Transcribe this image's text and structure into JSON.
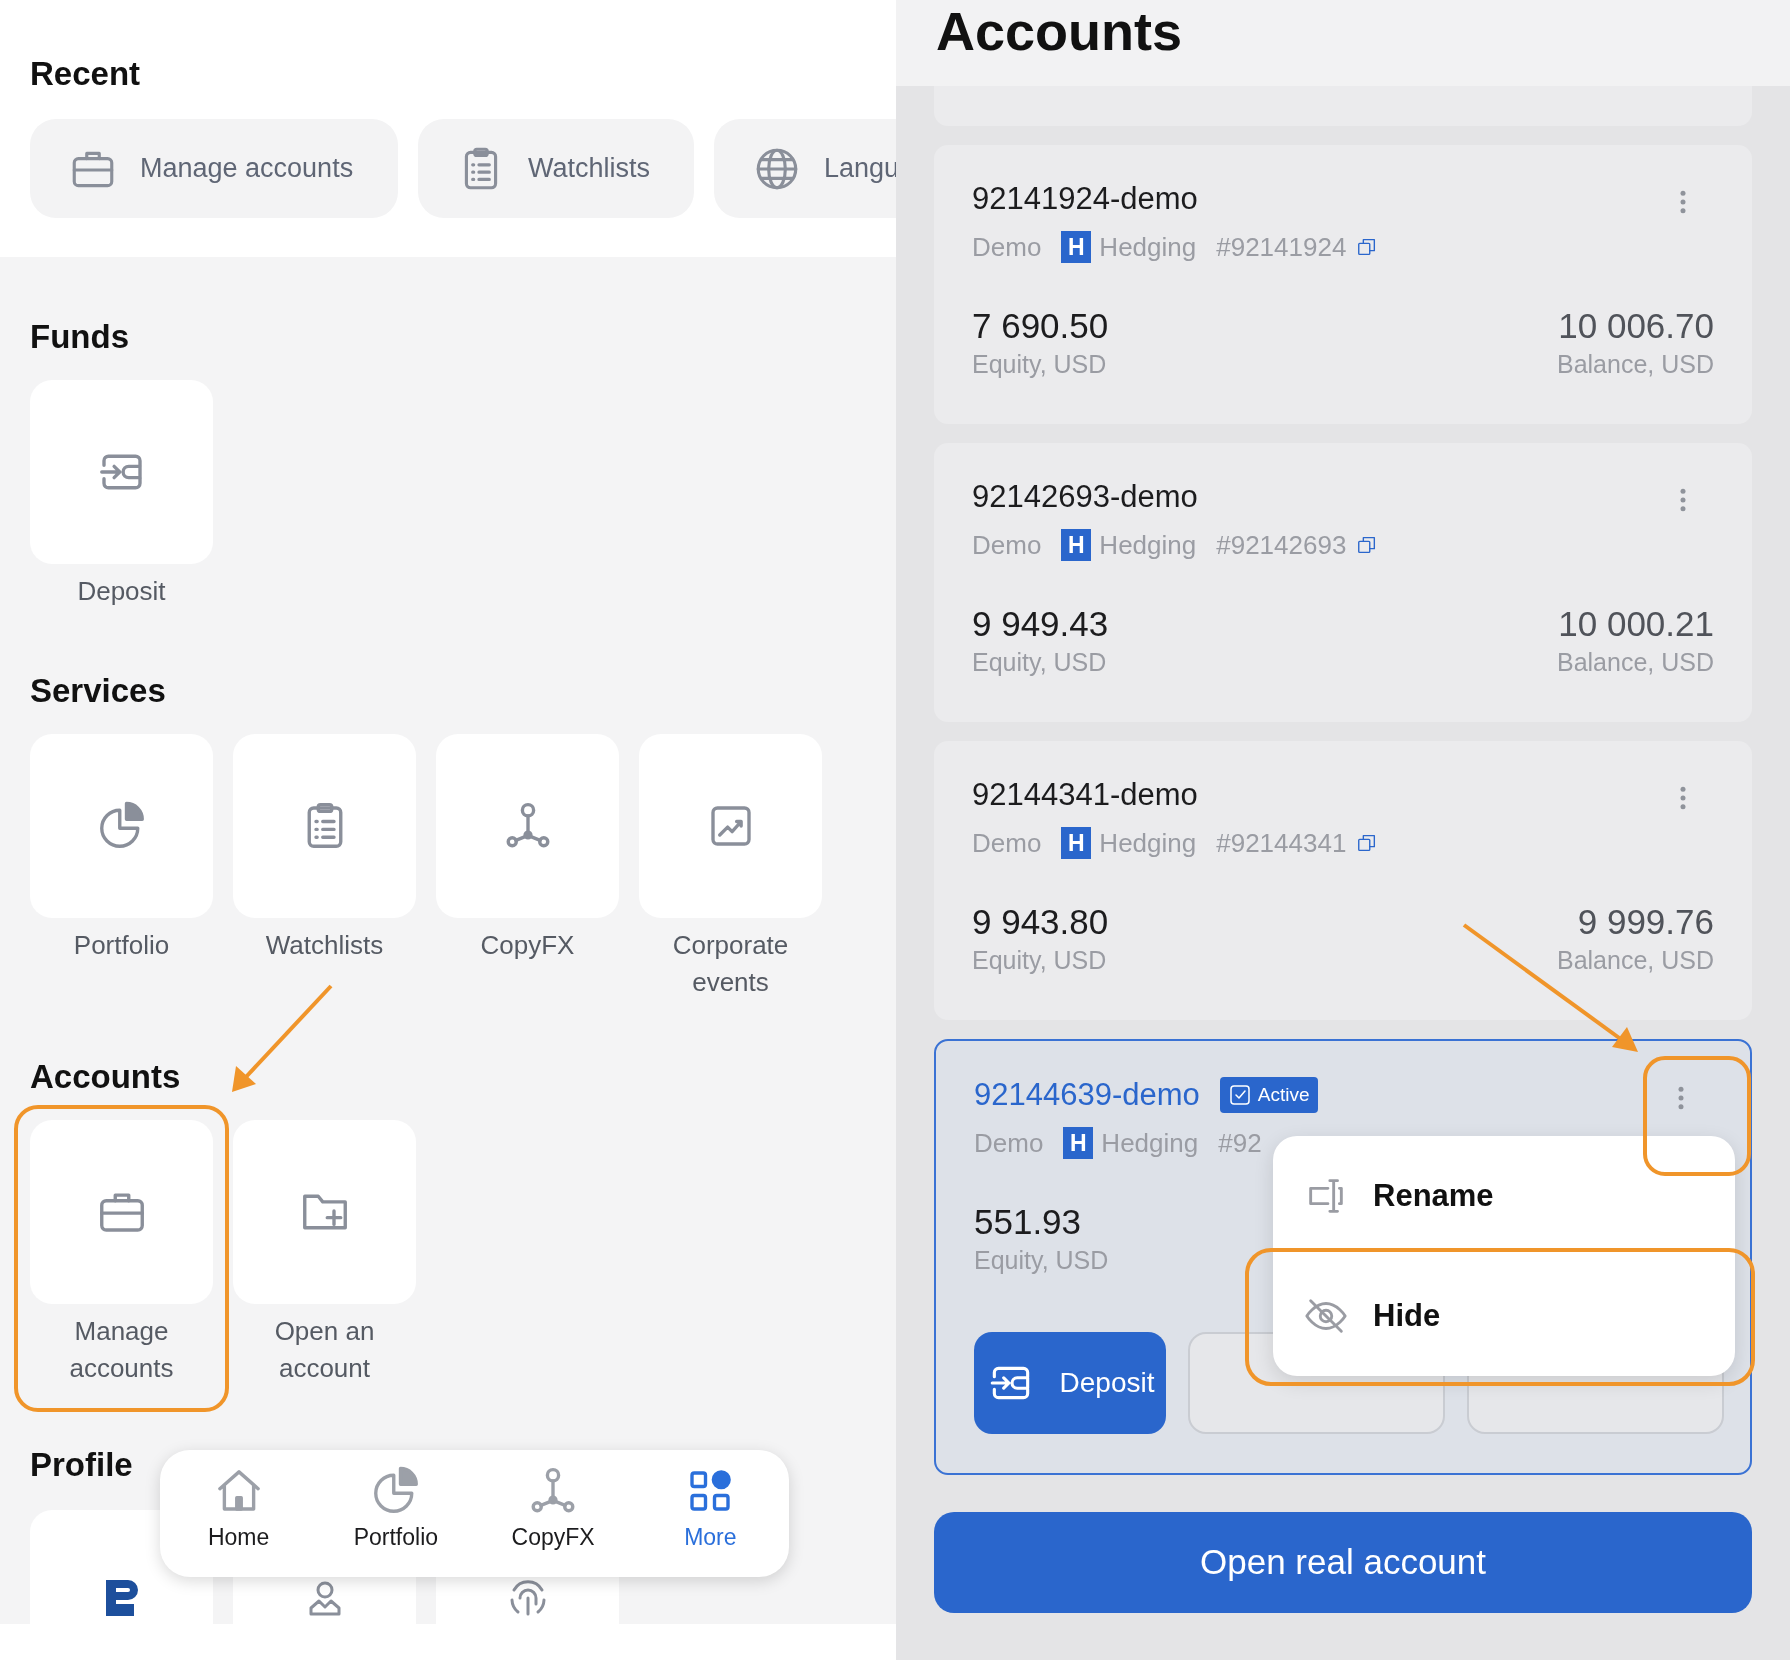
{
  "more_screen": {
    "recent": {
      "title": "Recent",
      "items": [
        {
          "label": "Manage accounts"
        },
        {
          "label": "Watchlists"
        },
        {
          "label": "Langu"
        }
      ]
    },
    "funds": {
      "title": "Funds",
      "tiles": [
        {
          "label": "Deposit"
        }
      ]
    },
    "services": {
      "title": "Services",
      "tiles": [
        {
          "label": "Portfolio"
        },
        {
          "label": "Watchlists"
        },
        {
          "label": "CopyFX"
        },
        {
          "label": "Corporate events"
        }
      ]
    },
    "accounts": {
      "title": "Accounts",
      "tiles": [
        {
          "label": "Manage accounts"
        },
        {
          "label": "Open an account"
        }
      ]
    },
    "profile": {
      "title": "Profile"
    },
    "bottom_nav": [
      {
        "label": "Home",
        "selected": false
      },
      {
        "label": "Portfolio",
        "selected": false
      },
      {
        "label": "CopyFX",
        "selected": false
      },
      {
        "label": "More",
        "selected": true
      }
    ]
  },
  "accounts_screen": {
    "title": "Accounts",
    "accounts": [
      {
        "name": "92141924-demo",
        "active": false,
        "type": "Demo",
        "badge": "H",
        "mode": "Hedging",
        "number": "#92141924",
        "equity": "7 690.50",
        "equity_label": "Equity, USD",
        "balance": "10 006.70",
        "balance_label": "Balance, USD"
      },
      {
        "name": "92142693-demo",
        "active": false,
        "type": "Demo",
        "badge": "H",
        "mode": "Hedging",
        "number": "#92142693",
        "equity": "9 949.43",
        "equity_label": "Equity, USD",
        "balance": "10 000.21",
        "balance_label": "Balance, USD"
      },
      {
        "name": "92144341-demo",
        "active": false,
        "type": "Demo",
        "badge": "H",
        "mode": "Hedging",
        "number": "#92144341",
        "equity": "9 943.80",
        "equity_label": "Equity, USD",
        "balance": "9 999.76",
        "balance_label": "Balance, USD"
      },
      {
        "name": "92144639-demo",
        "active": true,
        "status": "Active",
        "type": "Demo",
        "badge": "H",
        "mode": "Hedging",
        "number": "#92",
        "equity": "551.93",
        "equity_label": "Equity, USD",
        "actions": [
          {
            "kind": "primary",
            "label": "Deposit"
          },
          {
            "kind": "outline"
          },
          {
            "kind": "outline"
          }
        ],
        "menu": [
          {
            "label": "Rename"
          },
          {
            "label": "Hide"
          }
        ]
      }
    ],
    "open_button": "Open real account"
  }
}
